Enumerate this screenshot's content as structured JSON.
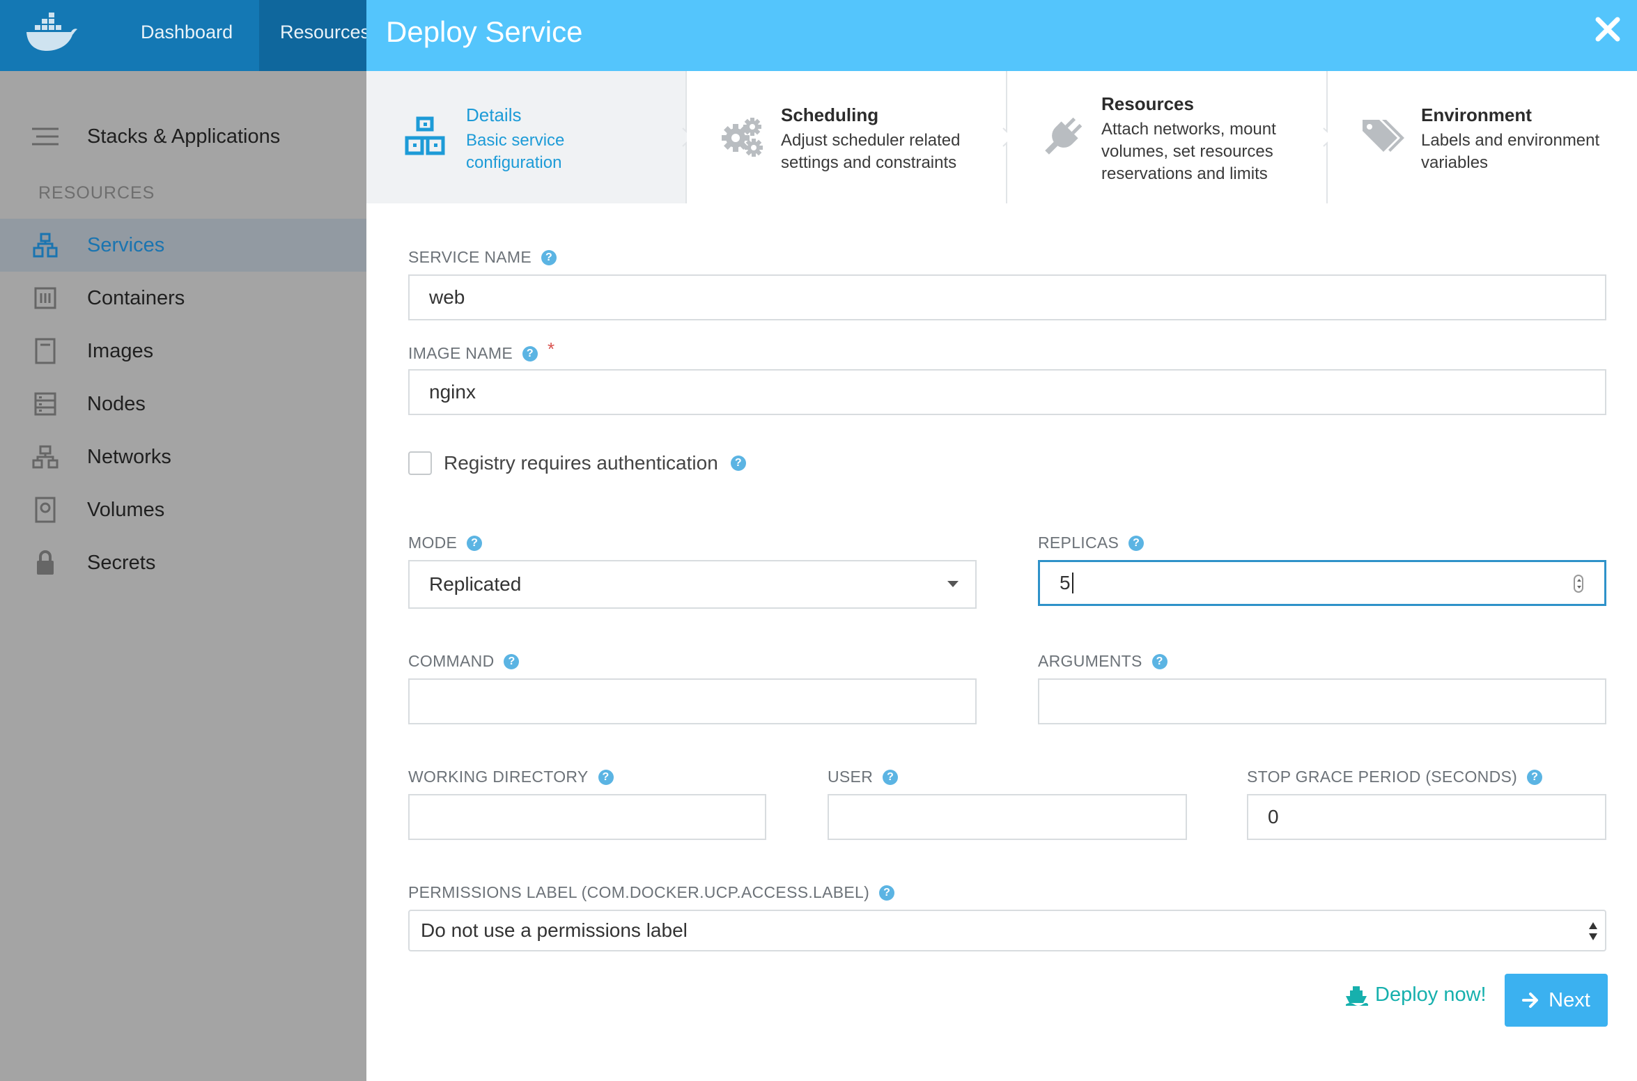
{
  "topbar": {
    "nav_dashboard": "Dashboard",
    "nav_resources": "Resources"
  },
  "sidebar": {
    "stacks_label": "Stacks & Applications",
    "section_heading": "RESOURCES",
    "items": [
      {
        "label": "Services",
        "icon": "services-icon",
        "active": true
      },
      {
        "label": "Containers",
        "icon": "containers-icon"
      },
      {
        "label": "Images",
        "icon": "images-icon"
      },
      {
        "label": "Nodes",
        "icon": "nodes-icon"
      },
      {
        "label": "Networks",
        "icon": "networks-icon"
      },
      {
        "label": "Volumes",
        "icon": "volumes-icon"
      },
      {
        "label": "Secrets",
        "icon": "lock-icon"
      }
    ]
  },
  "modal": {
    "title": "Deploy Service",
    "steps": [
      {
        "title": "Details",
        "desc": "Basic service configuration",
        "icon": "blocks-icon",
        "active": true
      },
      {
        "title": "Scheduling",
        "desc": "Adjust scheduler related settings and constraints",
        "icon": "gears-icon"
      },
      {
        "title": "Resources",
        "desc": "Attach networks, mount volumes, set resources reservations and limits",
        "icon": "plug-icon"
      },
      {
        "title": "Environment",
        "desc": "Labels and environment variables",
        "icon": "tags-icon"
      }
    ]
  },
  "form": {
    "service_name_label": "SERVICE NAME",
    "service_name_value": "web",
    "image_name_label": "IMAGE NAME",
    "image_name_required": "*",
    "image_name_value": "nginx",
    "registry_auth_label": "Registry requires authentication",
    "mode_label": "MODE",
    "mode_value": "Replicated",
    "replicas_label": "REPLICAS",
    "replicas_value": "5",
    "command_label": "COMMAND",
    "command_value": "",
    "arguments_label": "ARGUMENTS",
    "arguments_value": "",
    "working_dir_label": "WORKING DIRECTORY",
    "working_dir_value": "",
    "user_label": "USER",
    "user_value": "",
    "stop_grace_label": "STOP GRACE PERIOD (SECONDS)",
    "stop_grace_value": "0",
    "permissions_label": "PERMISSIONS LABEL (COM.DOCKER.UCP.ACCESS.LABEL)",
    "permissions_value": "Do not use a permissions label",
    "help_glyph": "?"
  },
  "actions": {
    "deploy_now": "Deploy now!",
    "next": "Next"
  },
  "colors": {
    "header_blue": "#54c5fc",
    "topbar_blue": "#1478b4",
    "accent_teal": "#16b0ad",
    "button_blue": "#3bb1f0",
    "help_blue": "#5bb4e3"
  }
}
